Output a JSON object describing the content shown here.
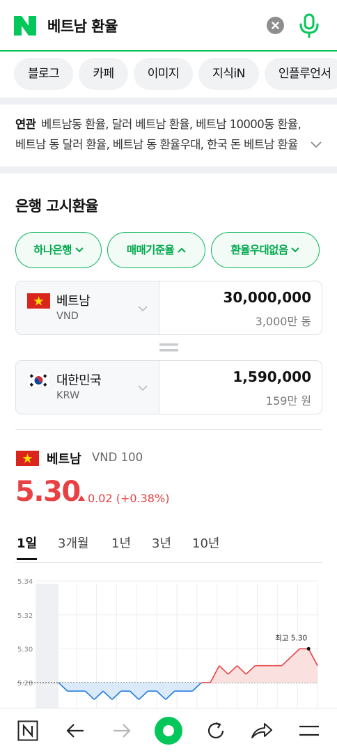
{
  "search": {
    "query": "베트남 환율"
  },
  "tabs": [
    "블로그",
    "카페",
    "이미지",
    "지식iN",
    "인플루언서"
  ],
  "related": {
    "label": "연관",
    "text": "베트남동 환율, 달러 베트남 환율, 베트남 10000동 환율, 베트남 동 달러 환율, 베트남 동 환율우대, 한국 돈 베트남 환율"
  },
  "exchange": {
    "title": "은행 고시환율",
    "filters": [
      "하나은행",
      "매매기준율",
      "환율우대없음"
    ],
    "from": {
      "name": "베트남",
      "code": "VND",
      "amount": "30,000,000",
      "amount_korean": "3,000만 동"
    },
    "to": {
      "name": "대한민국",
      "code": "KRW",
      "amount": "1,590,000",
      "amount_korean": "159만 원"
    }
  },
  "rate": {
    "name": "베트남",
    "unit": "VND 100",
    "value": "5.30",
    "change": "0.02 (+0.38%)",
    "direction": "up",
    "color_up": "#e84143"
  },
  "periods": [
    "1일",
    "3개월",
    "1년",
    "3년",
    "10년"
  ],
  "chart_data": {
    "type": "line",
    "y_ticks": [
      "5.34",
      "5.32",
      "5.30",
      "5.28"
    ],
    "ylim": [
      5.27,
      5.345
    ],
    "previous_close": 5.28,
    "max_label": "최고 5.30",
    "series": [
      {
        "values": [
          5.28,
          5.275,
          5.275,
          5.275,
          5.27,
          5.275,
          5.27,
          5.275,
          5.275,
          5.27,
          5.275,
          5.275,
          5.27,
          5.275,
          5.275,
          5.275,
          5.28,
          5.28,
          5.29,
          5.285,
          5.29,
          5.285,
          5.29,
          5.29,
          5.29,
          5.29,
          5.295,
          5.3,
          5.3,
          5.29
        ]
      }
    ]
  },
  "accent": "#03c75a",
  "bottom_nav": [
    "naver-home-icon",
    "back-icon",
    "forward-icon",
    "green-dot-icon",
    "refresh-icon",
    "share-icon",
    "menu-icon"
  ]
}
